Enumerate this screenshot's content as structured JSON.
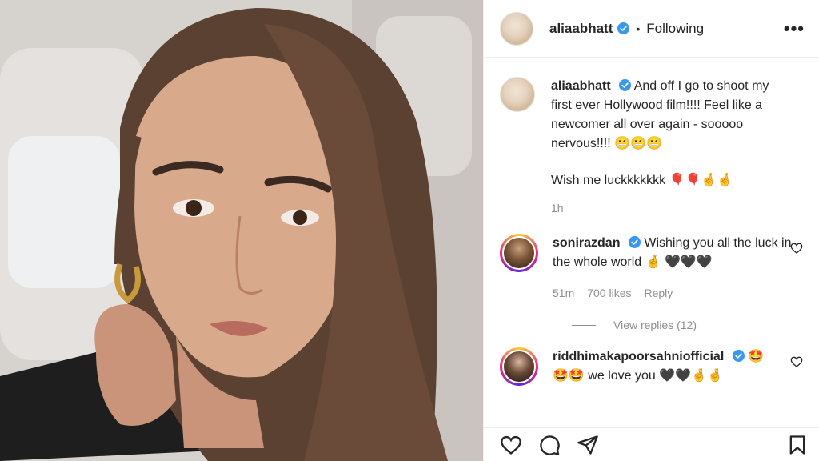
{
  "post": {
    "username": "aliaabhatt",
    "follow_dot": "•",
    "follow_status": "Following",
    "more_label": "•••"
  },
  "caption": {
    "username": "aliaabhatt",
    "text": "And off I go to shoot my first ever Hollywood film!!!! Feel like a newcomer all over again - sooooo nervous!!!! 😬😬😬",
    "text2": "Wish me luckkkkkkk 🎈🎈🤞🤞",
    "time": "1h"
  },
  "comments": [
    {
      "username": "sonirazdan",
      "text": "Wishing you all the luck in the whole world 🤞 🖤🖤🖤",
      "time": "51m",
      "likes": "700 likes",
      "reply": "Reply",
      "view_replies": "View replies (12)"
    },
    {
      "username": "riddhimakapoorsahniofficial",
      "text": "🤩🤩 we love you 🖤🖤🤞🤞",
      "badge_emoji": "🤩"
    }
  ],
  "icons": {
    "verified": "verified-badge-icon",
    "like": "heart-icon",
    "comment": "comment-icon",
    "share": "share-icon",
    "save": "bookmark-icon"
  },
  "colors": {
    "verified_blue": "#3897f0",
    "text": "#262626",
    "muted": "#8e8e8e"
  }
}
